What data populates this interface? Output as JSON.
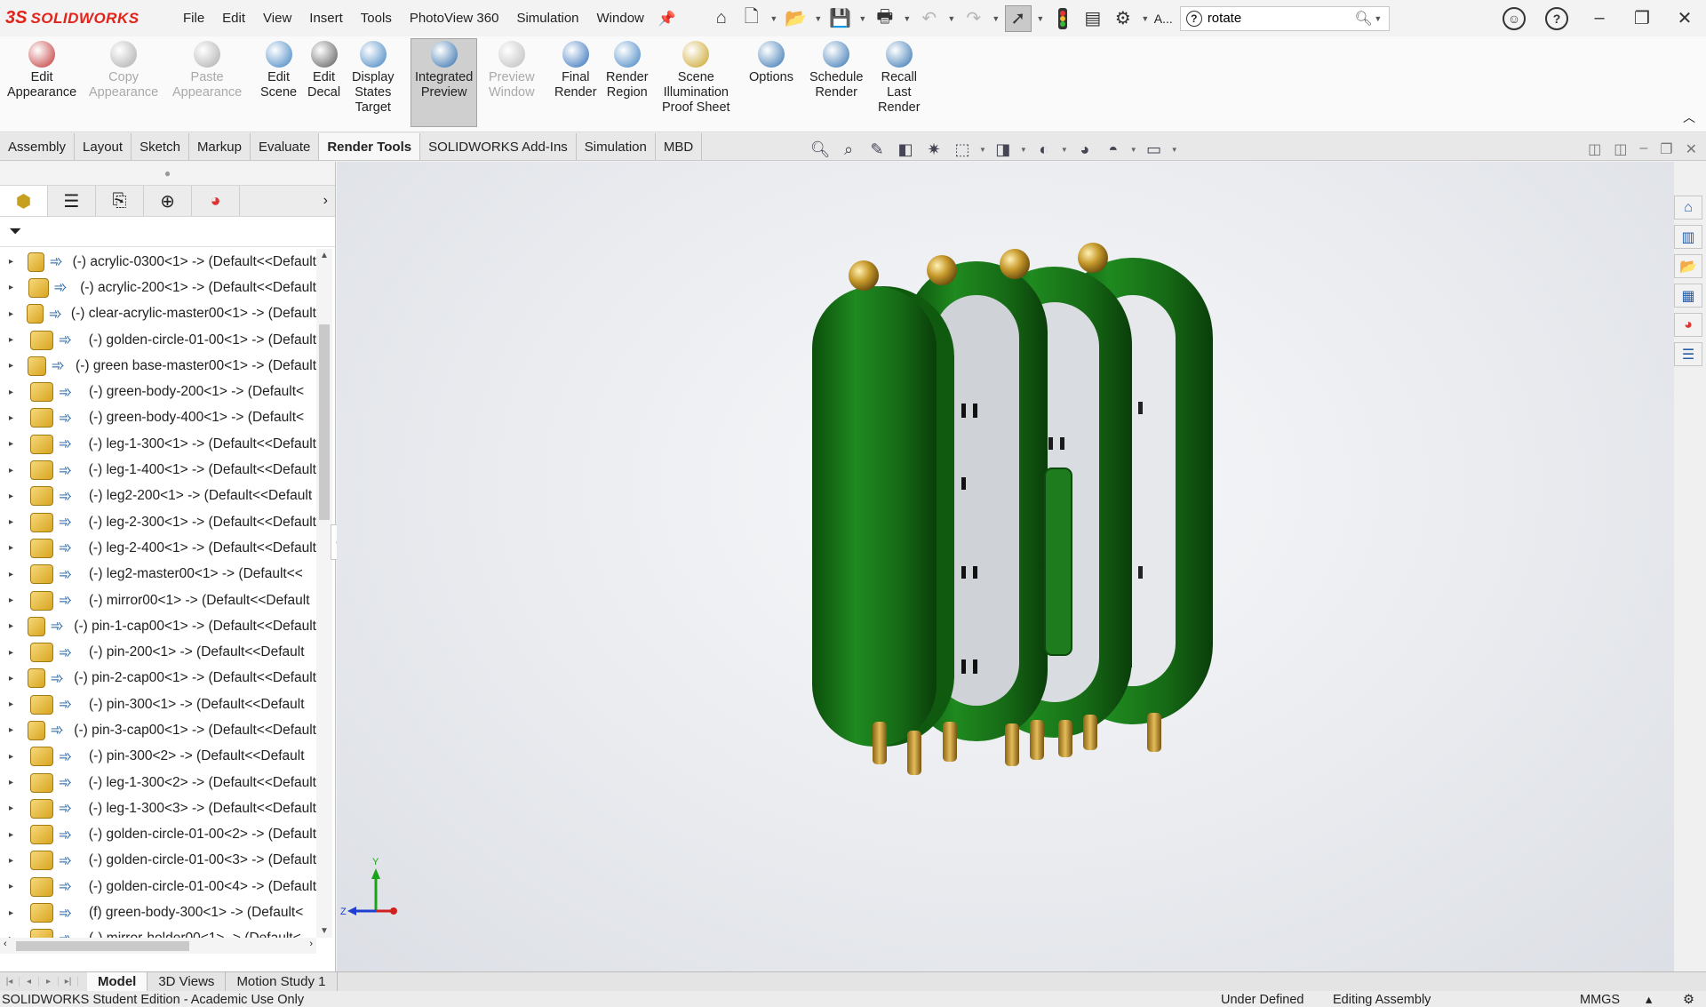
{
  "app": {
    "logo_ds": "3S",
    "logo_name": "SOLIDWORKS"
  },
  "menus": [
    "File",
    "Edit",
    "View",
    "Insert",
    "Tools",
    "PhotoView 360",
    "Simulation",
    "Window"
  ],
  "quick_access": {
    "more_label": "A..."
  },
  "search": {
    "value": "rotate"
  },
  "ribbon": {
    "buttons": [
      {
        "id": "edit-appearance",
        "line1": "Edit",
        "line2": "Appearance",
        "line3": "",
        "enabled": true
      },
      {
        "id": "copy-appearance",
        "line1": "Copy",
        "line2": "Appearance",
        "line3": "",
        "enabled": false
      },
      {
        "id": "paste-appearance",
        "line1": "Paste",
        "line2": "Appearance",
        "line3": "",
        "enabled": false
      },
      {
        "id": "edit-scene",
        "line1": "Edit",
        "line2": "Scene",
        "line3": "",
        "enabled": true
      },
      {
        "id": "edit-decal",
        "line1": "Edit",
        "line2": "Decal",
        "line3": "",
        "enabled": true
      },
      {
        "id": "display-states-target",
        "line1": "Display",
        "line2": "States",
        "line3": "Target",
        "enabled": true
      },
      {
        "id": "integrated-preview",
        "line1": "Integrated",
        "line2": "Preview",
        "line3": "",
        "enabled": true,
        "active": true
      },
      {
        "id": "preview-window",
        "line1": "Preview",
        "line2": "Window",
        "line3": "",
        "enabled": false
      },
      {
        "id": "final-render",
        "line1": "Final",
        "line2": "Render",
        "line3": "",
        "enabled": true
      },
      {
        "id": "render-region",
        "line1": "Render",
        "line2": "Region",
        "line3": "",
        "enabled": true
      },
      {
        "id": "scene-illumination-proof-sheet",
        "line1": "Scene",
        "line2": "Illumination",
        "line3": "Proof Sheet",
        "enabled": true
      },
      {
        "id": "options",
        "line1": "Options",
        "line2": "",
        "line3": "",
        "enabled": true
      },
      {
        "id": "schedule-render",
        "line1": "Schedule",
        "line2": "Render",
        "line3": "",
        "enabled": true
      },
      {
        "id": "recall-last-render",
        "line1": "Recall",
        "line2": "Last",
        "line3": "Render",
        "enabled": true
      }
    ]
  },
  "command_tabs": [
    {
      "label": "Assembly",
      "active": false
    },
    {
      "label": "Layout",
      "active": false
    },
    {
      "label": "Sketch",
      "active": false
    },
    {
      "label": "Markup",
      "active": false
    },
    {
      "label": "Evaluate",
      "active": false
    },
    {
      "label": "Render Tools",
      "active": true
    },
    {
      "label": "SOLIDWORKS Add-Ins",
      "active": false
    },
    {
      "label": "Simulation",
      "active": false
    },
    {
      "label": "MBD",
      "active": false
    }
  ],
  "tree": {
    "items": [
      "(-) acrylic-0300<1> -> (Default<<Default",
      "(-) acrylic-200<1> -> (Default<<Default",
      "(-) clear-acrylic-master00<1> -> (Default",
      "(-) golden-circle-01-00<1> -> (Default",
      "(-) green base-master00<1> -> (Default",
      "(-) green-body-200<1> -> (Default<",
      "(-) green-body-400<1> -> (Default<",
      "(-) leg-1-300<1> -> (Default<<Default",
      "(-) leg-1-400<1> -> (Default<<Default",
      "(-) leg2-200<1> -> (Default<<Default",
      "(-) leg-2-300<1> -> (Default<<Default",
      "(-) leg-2-400<1> -> (Default<<Default",
      "(-) leg2-master00<1> -> (Default<<",
      "(-) mirror00<1> -> (Default<<Default",
      "(-) pin-1-cap00<1> -> (Default<<Default",
      "(-) pin-200<1> -> (Default<<Default",
      "(-) pin-2-cap00<1> -> (Default<<Default",
      "(-) pin-300<1> -> (Default<<Default",
      "(-) pin-3-cap00<1> -> (Default<<Default",
      "(-) pin-300<2> -> (Default<<Default",
      "(-) leg-1-300<2> -> (Default<<Default",
      "(-) leg-1-300<3> -> (Default<<Default",
      "(-) golden-circle-01-00<2> -> (Default",
      "(-) golden-circle-01-00<3> -> (Default",
      "(-) golden-circle-01-00<4> -> (Default",
      "(f) green-body-300<1> -> (Default<",
      "(-) mirror-holder00<1> -> (Default<"
    ]
  },
  "triad": {
    "y": "Y",
    "z": "Z"
  },
  "bottom_tabs": [
    {
      "label": "Model",
      "active": true
    },
    {
      "label": "3D Views",
      "active": false
    },
    {
      "label": "Motion Study 1",
      "active": false
    }
  ],
  "status": {
    "left": "SOLIDWORKS Student Edition - Academic Use Only",
    "under_defined": "Under Defined",
    "editing": "Editing Assembly",
    "units": "MMGS",
    "units_arrow": "▴"
  },
  "colors": {
    "green": "#1f7a1f",
    "green_dark": "#0f4d0f",
    "gold": "#c69a2e",
    "brand_red": "#e2231a"
  }
}
